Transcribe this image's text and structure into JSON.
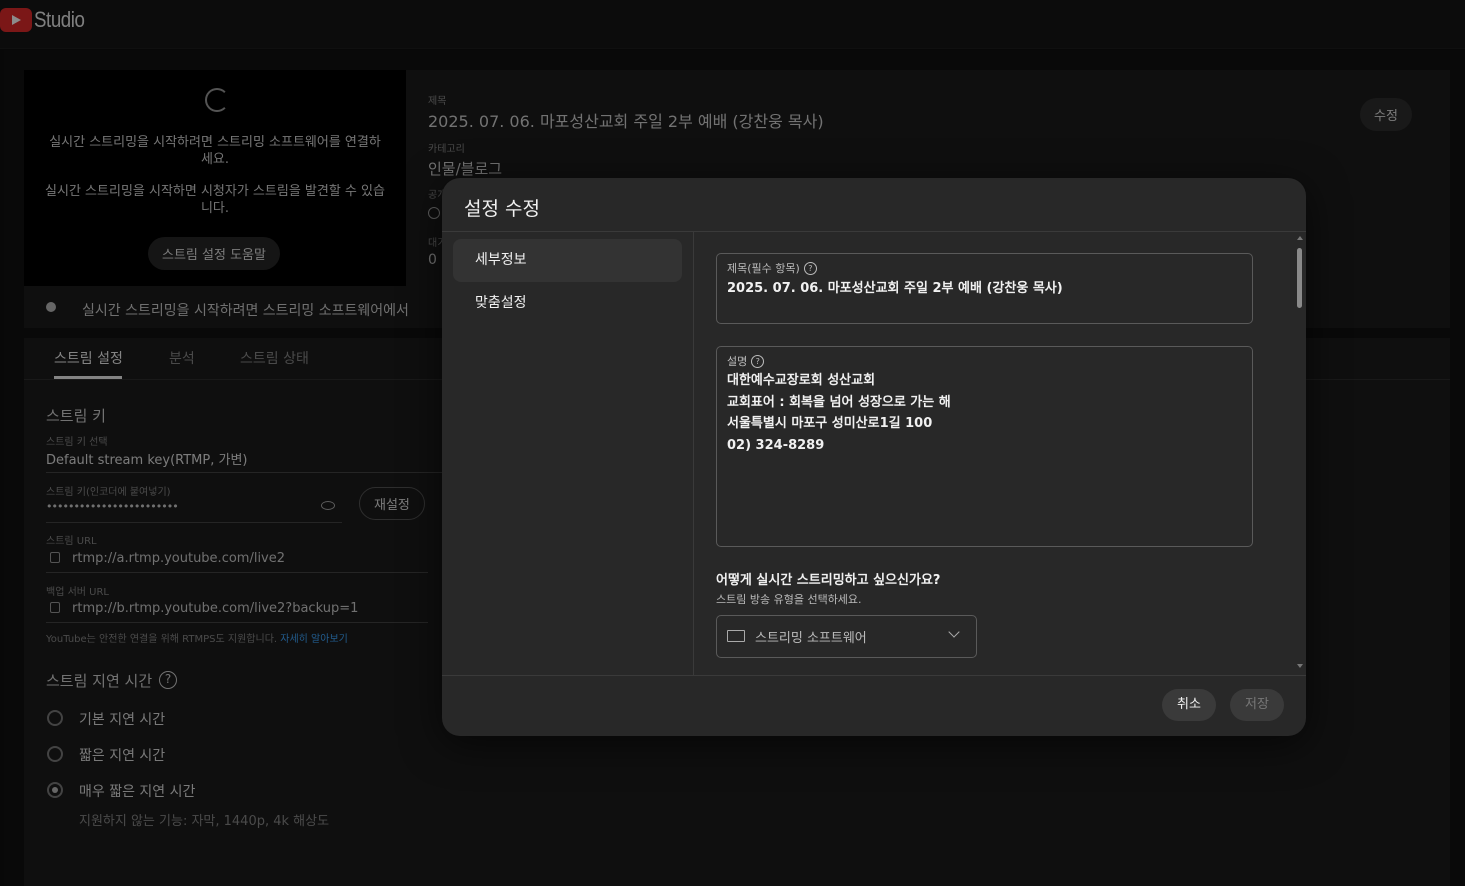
{
  "app": {
    "logo_text": "Studio"
  },
  "preview": {
    "msg1": "실시간 스트리밍을 시작하려면 스트리밍 소프트웨어를 연결하세요.",
    "msg2": "실시간 스트리밍을 시작하면 시청자가 스트림을 발견할 수 있습니다.",
    "help_button": "스트림 설정 도움말"
  },
  "info": {
    "title_label": "제목",
    "title_value": "2025. 07. 06. 마포성산교회 주일 2부 예배 (강찬웅 목사)",
    "category_label": "카테고리",
    "category_value": "인물/블로그",
    "privacy_label": "공개",
    "audience_label": "대기",
    "audience_value": "0",
    "edit_button": "수정"
  },
  "status_bar": {
    "text": "실시간 스트리밍을 시작하려면 스트리밍 소프트웨어에서"
  },
  "tabs": [
    {
      "label": "스트림 설정"
    },
    {
      "label": "분석"
    },
    {
      "label": "스트림 상태"
    }
  ],
  "stream_key": {
    "section_title": "스트림 키",
    "select_label": "스트림 키 선택",
    "select_value": "Default stream key(RTMP, 가변)",
    "key_label": "스트림 키(인코더에 붙여넣기)",
    "key_value": "••••••••••••••••••••••••",
    "reset_button": "재설정",
    "url_label": "스트림 URL",
    "url_value": "rtmp://a.rtmp.youtube.com/live2",
    "backup_label": "백업 서버 URL",
    "backup_value": "rtmp://b.rtmp.youtube.com/live2?backup=1",
    "rtmps_note": "YouTube는 안전한 연결을 위해 RTMPS도 지원합니다.",
    "rtmps_link": "자세히 알아보기"
  },
  "latency": {
    "title": "스트림 지연 시간",
    "options": [
      {
        "label": "기본 지연 시간"
      },
      {
        "label": "짧은 지연 시간"
      },
      {
        "label": "매우 짧은 지연 시간"
      }
    ],
    "selected_index": 2,
    "note": "지원하지 않는 기능: 자막, 1440p, 4k 해상도"
  },
  "modal": {
    "title": "설정 수정",
    "nav": [
      {
        "label": "세부정보"
      },
      {
        "label": "맞춤설정"
      }
    ],
    "title_field_label": "제목(필수 항목)",
    "title_field_value": "2025. 07. 06. 마포성산교회 주일 2부 예배 (강찬웅 목사)",
    "desc_field_label": "설명",
    "desc_lines": [
      "대한예수교장로회 성산교회",
      "교회표어 : 회복을 넘어 성장으로 가는 해",
      "서울특별시 마포구 성미산로1길 100",
      "02) 324-8289"
    ],
    "stream_how_title": "어떻게 실시간 스트리밍하고 싶으신가요?",
    "stream_how_sub": "스트림 방송 유형을 선택하세요.",
    "stream_type_value": "스트리밍 소프트웨어",
    "cancel_button": "취소",
    "save_button": "저장"
  },
  "colors": {
    "accent_link": "#3ea6ff",
    "youtube_red": "#e12a2a"
  }
}
